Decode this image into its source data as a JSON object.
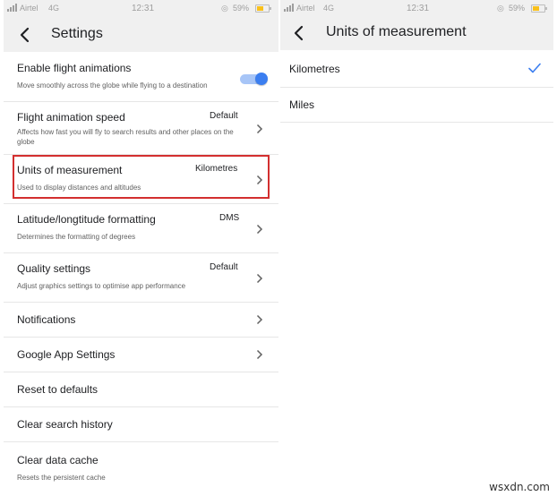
{
  "left": {
    "status": {
      "carrier": "Airtel",
      "network": "4G",
      "time": "12:31",
      "battery": "59%"
    },
    "title": "Settings",
    "rows": [
      {
        "title": "Enable flight animations",
        "subtitle": "Move smoothly across the globe while flying to a destination",
        "toggle_on": true
      },
      {
        "title": "Flight animation speed",
        "value": "Default",
        "subtitle": "Affects how fast you will fly to search results and other places on the globe"
      },
      {
        "title": "Units of measurement",
        "value": "Kilometres",
        "subtitle": "Used to display distances and altitudes"
      },
      {
        "title": "Latitude/longtitude formatting",
        "value": "DMS",
        "subtitle": "Determines the formatting of degrees"
      },
      {
        "title": "Quality settings",
        "value": "Default",
        "subtitle": "Adjust graphics settings to optimise app performance"
      },
      {
        "title": "Notifications"
      },
      {
        "title": "Google App Settings"
      },
      {
        "title": "Reset to defaults"
      },
      {
        "title": "Clear search history"
      },
      {
        "title": "Clear data cache",
        "subtitle": "Resets the persistent cache"
      }
    ]
  },
  "right": {
    "status": {
      "carrier": "Airtel",
      "network": "4G",
      "time": "12:31",
      "battery": "59%"
    },
    "title": "Units of measurement",
    "options": [
      {
        "label": "Kilometres",
        "selected": true
      },
      {
        "label": "Miles",
        "selected": false
      }
    ]
  },
  "watermark": "wsxdn.com",
  "colors": {
    "accent": "#3b7ef0",
    "highlight": "#d32f2f",
    "battery": "#f9c01b"
  }
}
